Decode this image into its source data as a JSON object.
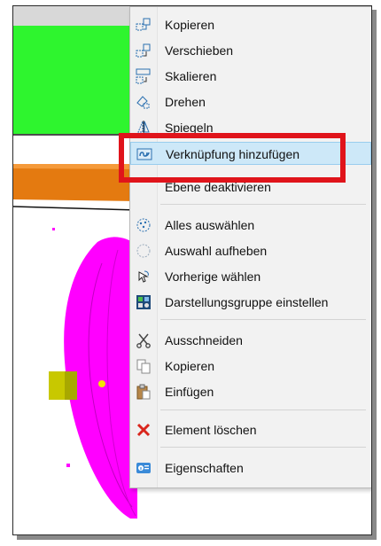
{
  "menu": {
    "items": [
      {
        "label": "Kopieren",
        "icon": "copy-transform-icon"
      },
      {
        "label": "Verschieben",
        "icon": "move-icon"
      },
      {
        "label": "Skalieren",
        "icon": "scale-icon"
      },
      {
        "label": "Drehen",
        "icon": "rotate-icon"
      },
      {
        "label": "Spiegeln",
        "icon": "mirror-icon"
      },
      {
        "label": "Verknüpfung hinzufügen",
        "icon": "add-link-icon",
        "highlighted": true
      },
      {
        "label": "Ebene deaktivieren",
        "icon": ""
      },
      {
        "label": "Alles auswählen",
        "icon": "select-all-icon"
      },
      {
        "label": "Auswahl aufheben",
        "icon": "deselect-icon"
      },
      {
        "label": "Vorherige wählen",
        "icon": "select-previous-icon"
      },
      {
        "label": "Darstellungsgruppe einstellen",
        "icon": "display-group-icon"
      },
      {
        "label": "Ausschneiden",
        "icon": "scissors-icon"
      },
      {
        "label": "Kopieren",
        "icon": "copy-icon"
      },
      {
        "label": "Einfügen",
        "icon": "paste-icon"
      },
      {
        "label": "Element löschen",
        "icon": "delete-icon"
      },
      {
        "label": "Eigenschaften",
        "icon": "properties-icon"
      }
    ]
  },
  "colors": {
    "highlight_bg": "#cde8f8",
    "annotation_red": "#e0141b",
    "model_green": "#2ef52e",
    "model_orange": "#e47a10",
    "model_magenta": "#ff00ff",
    "model_yellow": "#c8c800"
  }
}
